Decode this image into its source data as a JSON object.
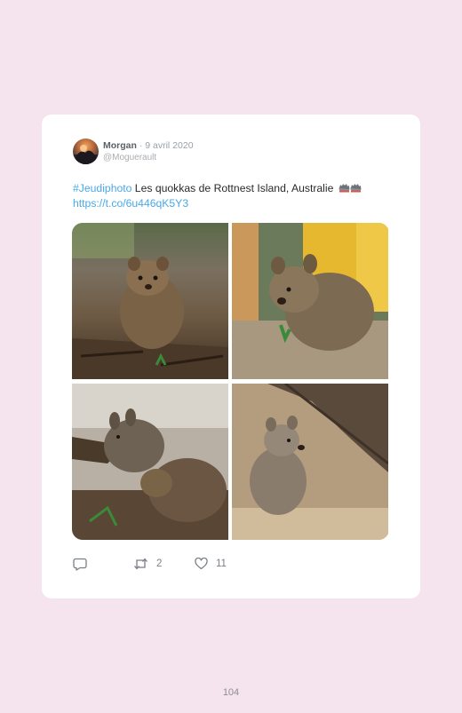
{
  "tweet": {
    "author_name": "Morgan",
    "date": "· 9 avril 2020",
    "handle": "@Moguerault",
    "hashtag": "#Jeudiphoto",
    "body": " Les quokkas de Rottnest Island, Australie ",
    "link": "https://t.co/6u446qK5Y3",
    "emoji_icon": "hedgehog-pair-icon"
  },
  "media": {
    "photos": [
      {
        "subject": "quokka"
      },
      {
        "subject": "quokka"
      },
      {
        "subject": "quokka"
      },
      {
        "subject": "quokka"
      }
    ]
  },
  "actions": {
    "reply_icon": "reply-icon",
    "retweet_icon": "retweet-icon",
    "retweet_count": "2",
    "like_icon": "heart-icon",
    "like_count": "11"
  },
  "colors": {
    "background": "#f5e4ee",
    "card": "#ffffff",
    "link": "#4aa8e8"
  },
  "page": {
    "number": "104"
  }
}
